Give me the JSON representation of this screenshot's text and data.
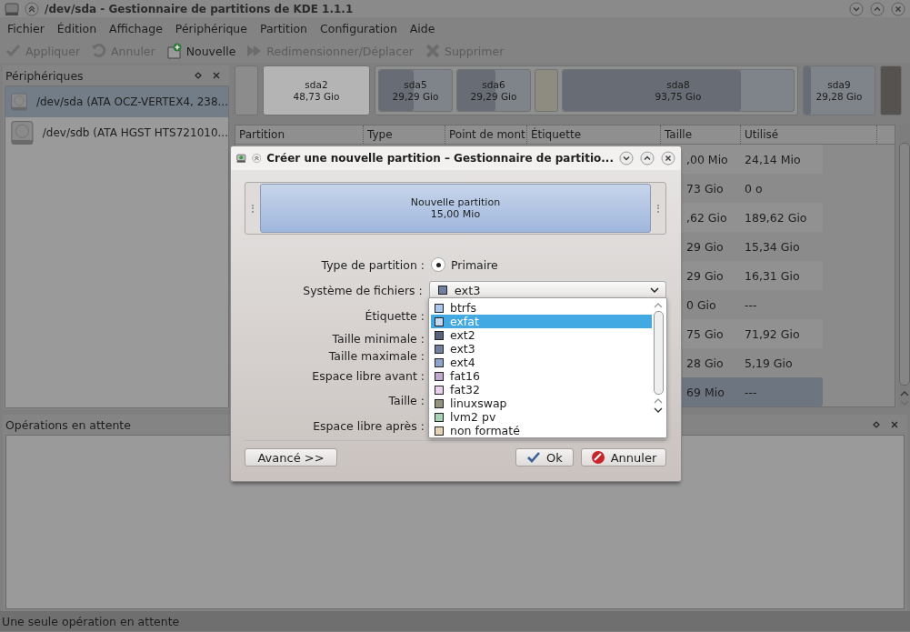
{
  "window": {
    "title": "/dev/sda - Gestionnaire de partitions de KDE 1.1.1"
  },
  "menu": [
    "Fichier",
    "Édition",
    "Affichage",
    "Périphérique",
    "Partition",
    "Configuration",
    "Aide"
  ],
  "toolbar": [
    {
      "label": "Appliquer",
      "disabled": true
    },
    {
      "label": "Annuler",
      "disabled": true
    },
    {
      "label": "Nouvelle",
      "disabled": false
    },
    {
      "label": "Redimensionner/Déplacer",
      "disabled": true
    },
    {
      "label": "Supprimer",
      "disabled": true
    }
  ],
  "devices_panel": {
    "title": "Périphériques",
    "items": [
      {
        "label": "/dev/sda (ATA OCZ-VERTEX4, 238...",
        "selected": true
      },
      {
        "label": "/dev/sdb (ATA HGST HTS721010...",
        "selected": false
      }
    ]
  },
  "partition_map": [
    {
      "kind": "free"
    },
    {
      "kind": "partition",
      "label": "sda2",
      "size": "48,73 Gio",
      "color": "#b4b4b4"
    },
    {
      "kind": "extended",
      "children": [
        {
          "kind": "partition",
          "label": "sda5",
          "size": "29,29 Gio",
          "color": "#7f838a",
          "level": 0.48
        },
        {
          "kind": "partition",
          "label": "sda6",
          "size": "29,29 Gio",
          "color": "#7f838a",
          "level": 0.52
        },
        {
          "kind": "partition",
          "color": "#8e8b80"
        },
        {
          "kind": "partition",
          "label": "sda8",
          "size": "93,75 Gio",
          "color": "#7f838a",
          "level": 0.77
        }
      ]
    },
    {
      "kind": "partition",
      "label": "sda9",
      "size": "29,28 Gio",
      "color": "#7f838a",
      "level": 0.1
    },
    {
      "kind": "partition",
      "color": "#55524f"
    }
  ],
  "table": {
    "columns": [
      "Partition",
      "Type",
      "Point de mont",
      "Étiquette",
      "Taille",
      "Utilisé"
    ],
    "rows": [
      {
        "size": ",00 Mio",
        "used": "24,14 Mio",
        "selected": false
      },
      {
        "size": "73 Gio",
        "used": "0 o",
        "selected": false
      },
      {
        "size": ",62 Gio",
        "used": "189,62 Gio",
        "selected": false
      },
      {
        "size": "29 Gio",
        "used": "15,34 Gio",
        "selected": false
      },
      {
        "size": "29 Gio",
        "used": "16,31 Gio",
        "selected": false
      },
      {
        "size": "0 Gio",
        "used": "---",
        "selected": false
      },
      {
        "size": "75 Gio",
        "used": "71,92 Gio",
        "selected": false
      },
      {
        "size": "28 Gio",
        "used": "5,19 Gio",
        "selected": false
      },
      {
        "size": "69 Mio",
        "used": "---",
        "selected": true
      }
    ]
  },
  "operations_panel": {
    "title": "Opérations en attente"
  },
  "status_bar": "Une seule opération en attente",
  "dialog": {
    "title": "Créer une nouvelle partition – Gestionnaire de partitio...",
    "preview": {
      "label": "Nouvelle partition",
      "size": "15,00 Mio"
    },
    "form": [
      {
        "label": "Type de partition :",
        "kind": "radio",
        "value": "Primaire",
        "checked": true
      },
      {
        "label": "Système de fichiers :",
        "kind": "combo",
        "value": "ext3",
        "color": "#7080a0"
      },
      {
        "label": "Étiquette :",
        "kind": "plain"
      },
      {
        "label": "Taille minimale :",
        "kind": "plain"
      },
      {
        "label": "Taille maximale :",
        "kind": "plain"
      },
      {
        "label": "Espace libre avant :",
        "kind": "plain"
      },
      {
        "label": "Taille :",
        "kind": "plain"
      },
      {
        "label": "Espace libre après :",
        "kind": "plain"
      }
    ],
    "dropdown": [
      {
        "label": "btrfs",
        "color": "#a8c8f0",
        "selected": false
      },
      {
        "label": "exfat",
        "color": "#c4daf2",
        "selected": true
      },
      {
        "label": "ext2",
        "color": "#56647e",
        "selected": false
      },
      {
        "label": "ext3",
        "color": "#7080a0",
        "selected": false
      },
      {
        "label": "ext4",
        "color": "#8ea4cc",
        "selected": false
      },
      {
        "label": "fat16",
        "color": "#c0a8d0",
        "selected": false
      },
      {
        "label": "fat32",
        "color": "#e8d0ec",
        "selected": false
      },
      {
        "label": "linuxswap",
        "color": "#94947c",
        "selected": false
      },
      {
        "label": "lvm2 pv",
        "color": "#a4d4b4",
        "selected": false
      },
      {
        "label": "non formaté",
        "color": "#e4d4b4",
        "selected": false
      }
    ],
    "buttons": [
      {
        "label": "Avancé >>",
        "kind": "advanced"
      },
      {
        "label": "Ok",
        "kind": "ok"
      },
      {
        "label": "Annuler",
        "kind": "cancel"
      }
    ]
  }
}
